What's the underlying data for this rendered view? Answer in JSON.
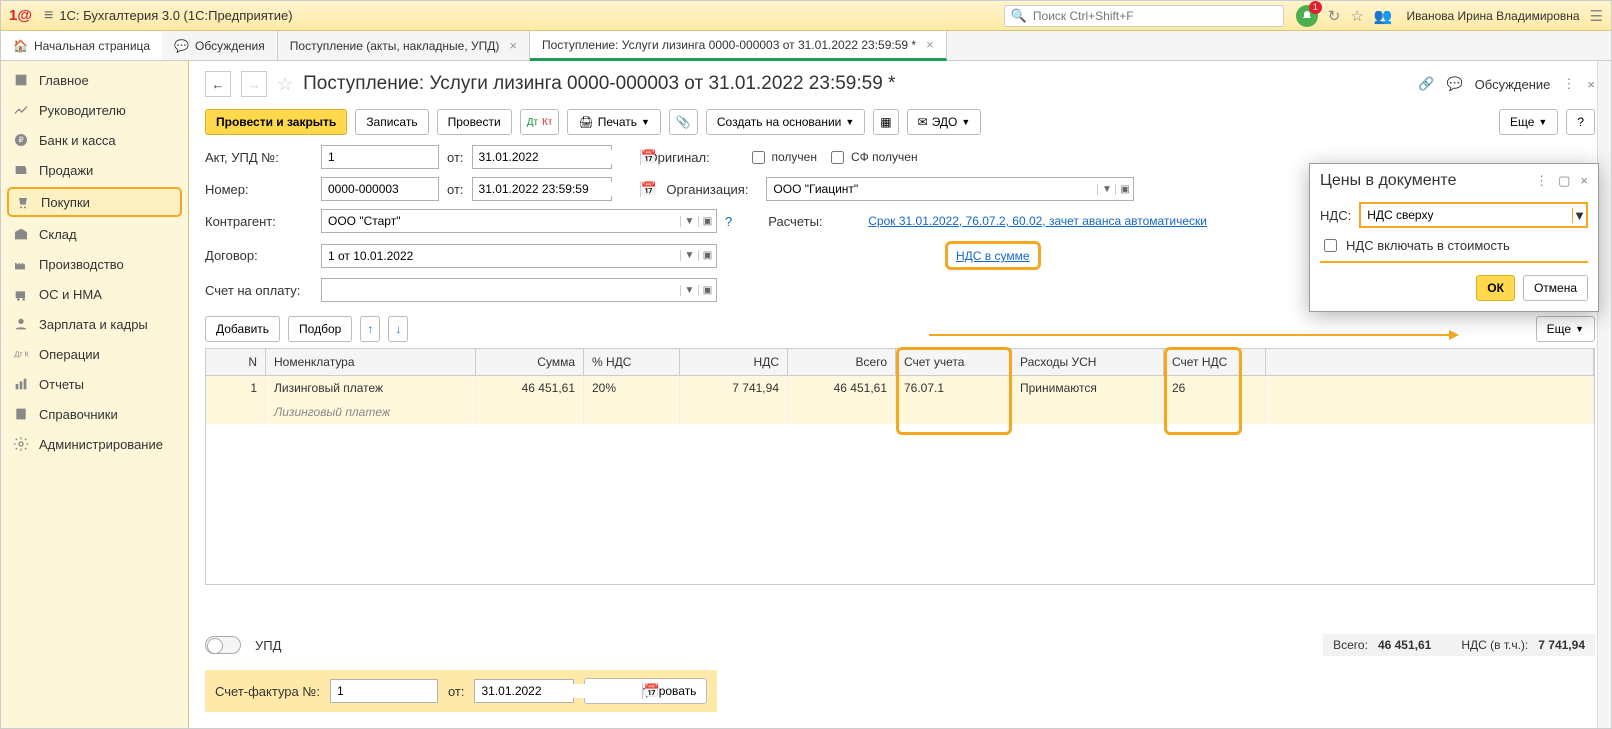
{
  "top": {
    "app_title": "1С: Бухгалтерия 3.0  (1С:Предприятие)",
    "search_ph": "Поиск Ctrl+Shift+F",
    "badge": "1",
    "user": "Иванова Ирина Владимировна"
  },
  "tabs": {
    "home": "Начальная страница",
    "t1": "Обсуждения",
    "t2": "Поступление (акты, накладные, УПД)",
    "t3": "Поступление: Услуги лизинга 0000-000003 от 31.01.2022 23:59:59 *"
  },
  "sidebar": [
    "Главное",
    "Руководителю",
    "Банк и касса",
    "Продажи",
    "Покупки",
    "Склад",
    "Производство",
    "ОС и НМА",
    "Зарплата и кадры",
    "Операции",
    "Отчеты",
    "Справочники",
    "Администрирование"
  ],
  "doc": {
    "title": "Поступление: Услуги лизинга 0000-000003 от 31.01.2022 23:59:59 *",
    "discuss": "Обсуждение",
    "btn_post_close": "Провести и закрыть",
    "btn_save": "Записать",
    "btn_post": "Провести",
    "btn_print": "Печать",
    "btn_based": "Создать на основании",
    "btn_edo": "ЭДО",
    "btn_more": "Еще",
    "btn_help": "?",
    "lab_act": "Акт, УПД №:",
    "act_no": "1",
    "lab_ot": "от:",
    "act_date": "31.01.2022",
    "lab_num": "Номер:",
    "num": "0000-000003",
    "num_date": "31.01.2022 23:59:59",
    "lab_orig": "Оригинал:",
    "cb_recv": "получен",
    "cb_sf": "СФ получен",
    "lab_org": "Организация:",
    "org": "ООО \"Гиацинт\"",
    "lab_contr": "Контрагент:",
    "contr": "ООО \"Старт\"",
    "lab_calc": "Расчеты:",
    "calc_link": "Срок 31.01.2022, 76.07.2, 60.02, зачет аванса автоматически",
    "lab_dog": "Договор:",
    "dog": "1 от 10.01.2022",
    "nds_link": "НДС в сумме",
    "lab_bill": "Счет на оплату:",
    "btn_add": "Добавить",
    "btn_sel": "Подбор",
    "tbl_more": "Еще"
  },
  "table": {
    "hdr": {
      "n": "N",
      "nom": "Номенклатура",
      "sum": "Сумма",
      "pnds": "% НДС",
      "nds": "НДС",
      "tot": "Всего",
      "acc": "Счет учета",
      "usn": "Расходы УСН",
      "ndsa": "Счет НДС"
    },
    "row": {
      "n": "1",
      "nom": "Лизинговый платеж",
      "nom2": "Лизинговый платеж",
      "sum": "46 451,61",
      "pnds": "20%",
      "nds": "7 741,94",
      "tot": "46 451,61",
      "acc": "76.07.1",
      "usn": "Принимаются",
      "ndsa": "26"
    }
  },
  "totals": {
    "upd": "УПД",
    "lab_tot": "Всего:",
    "tot": "46 451,61",
    "lab_nds": "НДС (в т.ч.):",
    "nds": "7 741,94"
  },
  "sf": {
    "lab": "Счет-фактура №:",
    "no": "1",
    "lab_ot": "от:",
    "date": "31.01.2022",
    "btn": "Зарегистрировать"
  },
  "popup": {
    "title": "Цены в документе",
    "lab_nds": "НДС:",
    "nds_val": "НДС сверху",
    "cb": "НДС включать в стоимость",
    "ok": "ОК",
    "cancel": "Отмена"
  }
}
